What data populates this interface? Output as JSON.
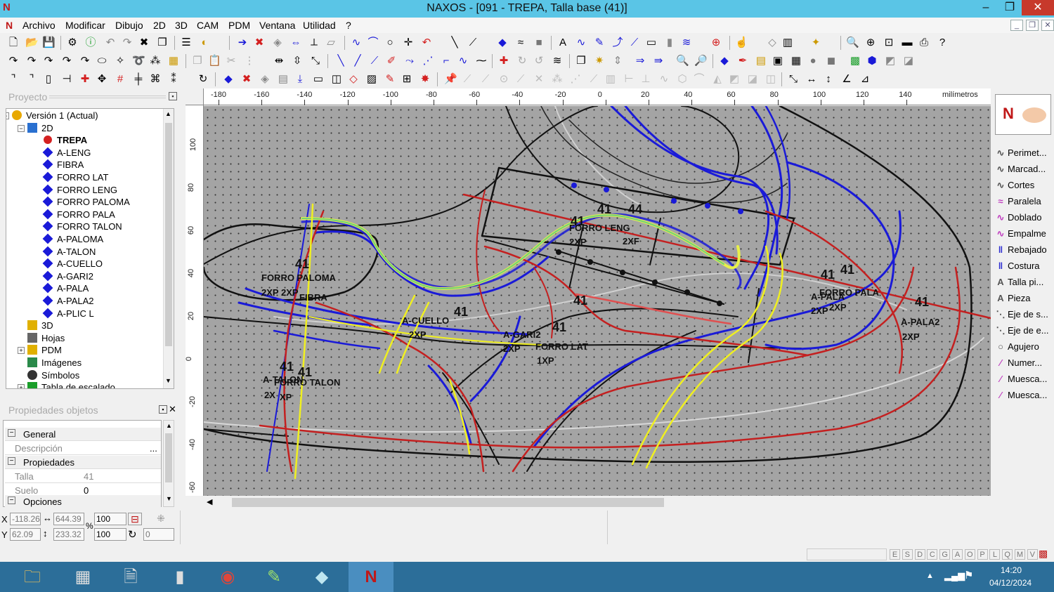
{
  "window": {
    "title": "NAXOS - [091 - TREPA, Talla base (41)]",
    "logo": "N",
    "min_glyph": "–",
    "max_glyph": "❐",
    "close_glyph": "✕"
  },
  "menu": {
    "items": [
      "Archivo",
      "Modificar",
      "Dibujo",
      "2D",
      "3D",
      "CAM",
      "PDM",
      "Ventana",
      "Utilidad",
      "?"
    ]
  },
  "project": {
    "header": "Proyecto",
    "tree": [
      {
        "label": "Versión 1 (Actual)",
        "level": 0,
        "icon": "version-icon",
        "expanded": true
      },
      {
        "label": "2D",
        "level": 1,
        "icon": "2d-icon",
        "expanded": true
      },
      {
        "label": "TREPA",
        "level": 2,
        "icon": "red-dot-icon",
        "bold": true
      },
      {
        "label": "A-LENG",
        "level": 2,
        "icon": "blue-diamond-icon"
      },
      {
        "label": "FIBRA",
        "level": 2,
        "icon": "blue-diamond-icon"
      },
      {
        "label": "FORRO LAT",
        "level": 2,
        "icon": "blue-diamond-icon"
      },
      {
        "label": "FORRO LENG",
        "level": 2,
        "icon": "blue-diamond-icon"
      },
      {
        "label": "FORRO PALOMA",
        "level": 2,
        "icon": "blue-diamond-icon"
      },
      {
        "label": "FORRO PALA",
        "level": 2,
        "icon": "blue-diamond-icon"
      },
      {
        "label": "FORRO TALON",
        "level": 2,
        "icon": "blue-diamond-icon"
      },
      {
        "label": "A-PALOMA",
        "level": 2,
        "icon": "blue-diamond-icon"
      },
      {
        "label": "A-TALON",
        "level": 2,
        "icon": "blue-diamond-icon"
      },
      {
        "label": "A-CUELLO",
        "level": 2,
        "icon": "blue-diamond-icon"
      },
      {
        "label": "A-GARI2",
        "level": 2,
        "icon": "blue-diamond-icon"
      },
      {
        "label": "A-PALA",
        "level": 2,
        "icon": "blue-diamond-icon"
      },
      {
        "label": "A-PALA2",
        "level": 2,
        "icon": "blue-diamond-icon"
      },
      {
        "label": "A-PLIC L",
        "level": 2,
        "icon": "blue-diamond-icon"
      },
      {
        "label": "3D",
        "level": 1,
        "icon": "3d-icon"
      },
      {
        "label": "Hojas",
        "level": 1,
        "icon": "sheets-icon"
      },
      {
        "label": "PDM",
        "level": 1,
        "icon": "folder-icon",
        "collapsed": true
      },
      {
        "label": "Imágenes",
        "level": 1,
        "icon": "images-icon"
      },
      {
        "label": "Símbolos",
        "level": 1,
        "icon": "symbols-icon"
      },
      {
        "label": "Tabla de escalado",
        "level": 1,
        "icon": "table-icon",
        "collapsed": true
      }
    ]
  },
  "properties": {
    "header": "Propiedades objetos",
    "groups": {
      "general": "General",
      "propiedades": "Propiedades",
      "opciones": "Opciones"
    },
    "descripcion": {
      "label": "Descripción",
      "value": "",
      "button": "..."
    },
    "talla": {
      "label": "Talla",
      "value": "41"
    },
    "suelo": {
      "label": "Suelo",
      "value": "0"
    }
  },
  "ruler": {
    "unit": "milímetros",
    "x_ticks": [
      "-180",
      "-160",
      "-140",
      "-120",
      "-100",
      "-80",
      "-60",
      "-40",
      "-20",
      "0",
      "20",
      "40",
      "60",
      "80",
      "100",
      "120",
      "140"
    ],
    "y_ticks": [
      "100",
      "80",
      "60",
      "40",
      "20",
      "0",
      "-20",
      "-40",
      "-60"
    ]
  },
  "drawing": {
    "labels": [
      {
        "t": "41"
      },
      {
        "t": "44"
      },
      {
        "t": "41"
      },
      {
        "t": "FORRO LENG"
      },
      {
        "t": "2XP"
      },
      {
        "t": "2XF"
      },
      {
        "t": "41"
      },
      {
        "t": "FORRO PALOMA"
      },
      {
        "t": "2XP"
      },
      {
        "t": "2XP"
      },
      {
        "t": "FIBRA"
      },
      {
        "t": "41"
      },
      {
        "t": "A-CUELLO"
      },
      {
        "t": "2XP"
      },
      {
        "t": "41"
      },
      {
        "t": "41"
      },
      {
        "t": "A-GARI2"
      },
      {
        "t": "2XP"
      },
      {
        "t": "FORRO LAT"
      },
      {
        "t": "1XP"
      },
      {
        "t": "41"
      },
      {
        "t": "41"
      },
      {
        "t": "A-TALON"
      },
      {
        "t": "FORRO TALON"
      },
      {
        "t": "2X"
      },
      {
        "t": "XP"
      },
      {
        "t": "41"
      },
      {
        "t": "41"
      },
      {
        "t": "A-PALA"
      },
      {
        "t": "FORRO PALA"
      },
      {
        "t": "2XP"
      },
      {
        "t": "2XP"
      },
      {
        "t": "41"
      },
      {
        "t": "A-PALA2"
      },
      {
        "t": "2XP"
      }
    ]
  },
  "right_panel": {
    "items": [
      {
        "label": "Perimet...",
        "icon": "curve-icon"
      },
      {
        "label": "Marcad...",
        "icon": "curve-icon"
      },
      {
        "label": "Cortes",
        "icon": "curve-icon"
      },
      {
        "label": "Paralela",
        "icon": "parallel-icon"
      },
      {
        "label": "Doblado",
        "icon": "fold-icon"
      },
      {
        "label": "Empalme",
        "icon": "join-icon"
      },
      {
        "label": "Rebajado",
        "icon": "skive-icon"
      },
      {
        "label": "Costura",
        "icon": "seam-icon"
      },
      {
        "label": "Talla pi...",
        "icon": "text-icon"
      },
      {
        "label": "Pieza",
        "icon": "text-icon"
      },
      {
        "label": "Eje de s...",
        "icon": "axis-icon"
      },
      {
        "label": "Eje de e...",
        "icon": "axis-icon"
      },
      {
        "label": "Agujero",
        "icon": "hole-icon"
      },
      {
        "label": "Numer...",
        "icon": "notch-icon"
      },
      {
        "label": "Muesca...",
        "icon": "notch-icon"
      },
      {
        "label": "Muesca...",
        "icon": "notch-icon"
      }
    ]
  },
  "coords": {
    "x_label": "X",
    "y_label": "Y",
    "x": "-118.26",
    "y": "62.09",
    "w": "644.39",
    "h": "233.32",
    "pct_label": "%",
    "scale_x": "100",
    "scale_y": "100",
    "rotation": "0"
  },
  "status": {
    "keys": [
      "E",
      "S",
      "D",
      "C",
      "G",
      "A",
      "O",
      "P",
      "L",
      "Q",
      "M",
      "V"
    ]
  },
  "taskbar": {
    "time": "14:20",
    "date": "04/12/2024"
  }
}
